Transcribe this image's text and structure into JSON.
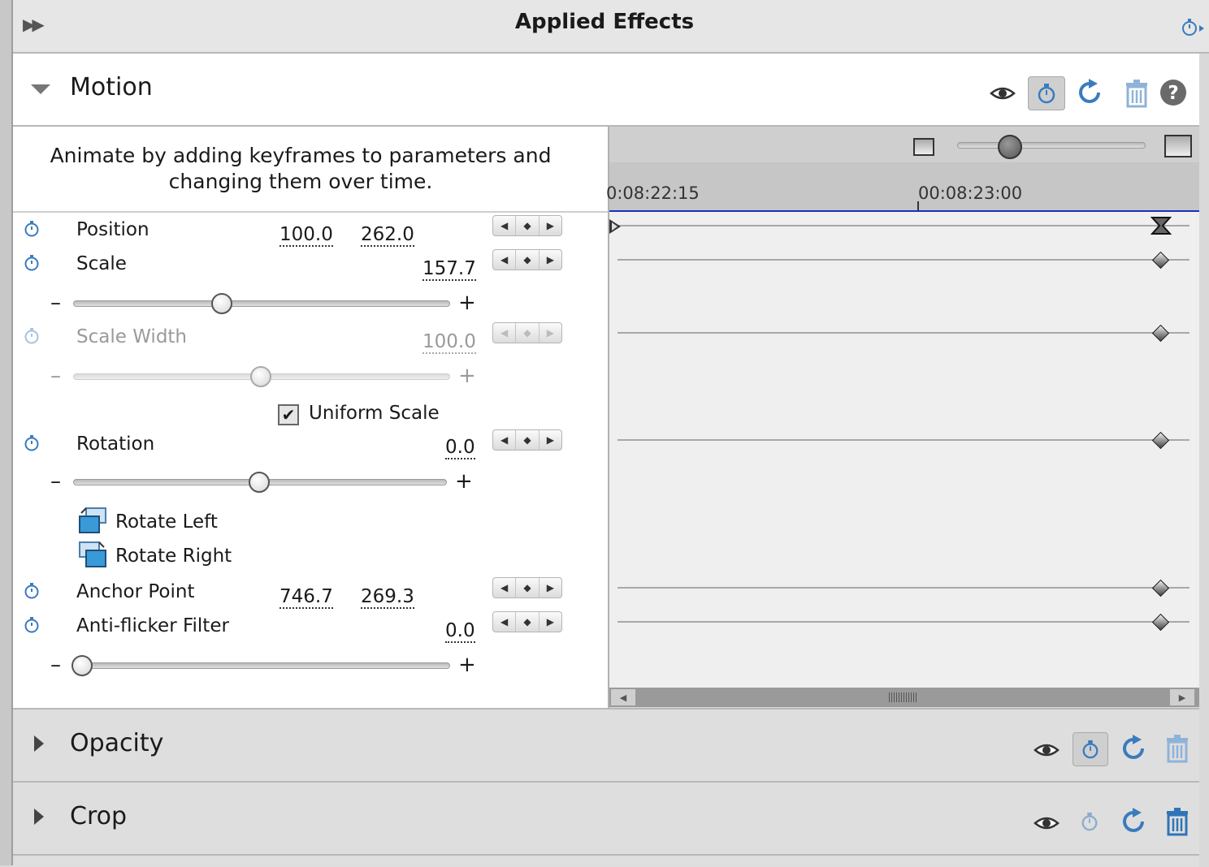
{
  "header": {
    "title": "Applied Effects"
  },
  "motion": {
    "title": "Motion",
    "hint": "Animate by adding keyframes to parameters and changing them over time.",
    "params": {
      "position": {
        "label": "Position",
        "x": "100.0",
        "y": "262.0"
      },
      "scale": {
        "label": "Scale",
        "value": "157.7",
        "slider_fraction": 0.39
      },
      "scale_width": {
        "label": "Scale Width",
        "value": "100.0",
        "slider_fraction": 0.5
      },
      "uniform_scale": {
        "label": "Uniform Scale",
        "checked": true,
        "check_glyph": "✔"
      },
      "rotation": {
        "label": "Rotation",
        "value": "0.0",
        "slider_fraction": 0.5
      },
      "rotate_left": {
        "label": "Rotate Left"
      },
      "rotate_right": {
        "label": "Rotate Right"
      },
      "anchor_point": {
        "label": "Anchor Point",
        "x": "746.7",
        "y": "269.3"
      },
      "anti_flicker": {
        "label": "Anti-flicker Filter",
        "value": "0.0",
        "slider_fraction": 0.0
      }
    },
    "slider_symbols": {
      "minus": "–",
      "plus": "+"
    }
  },
  "timeline": {
    "ticks": [
      "0:08:22:15",
      "00:08:23:00"
    ],
    "zoom_fraction": 0.25
  },
  "sections": {
    "opacity": {
      "title": "Opacity"
    },
    "crop": {
      "title": "Crop"
    }
  },
  "colors": {
    "accent": "#3a7bbf",
    "playhead_line": "#1a2fbf"
  },
  "icons": [
    "expand-panel-icon",
    "eye-icon",
    "stopwatch-icon",
    "reset-icon",
    "trash-icon",
    "help-icon",
    "checkbox-icon",
    "rotate-left-icon",
    "rotate-right-icon"
  ]
}
